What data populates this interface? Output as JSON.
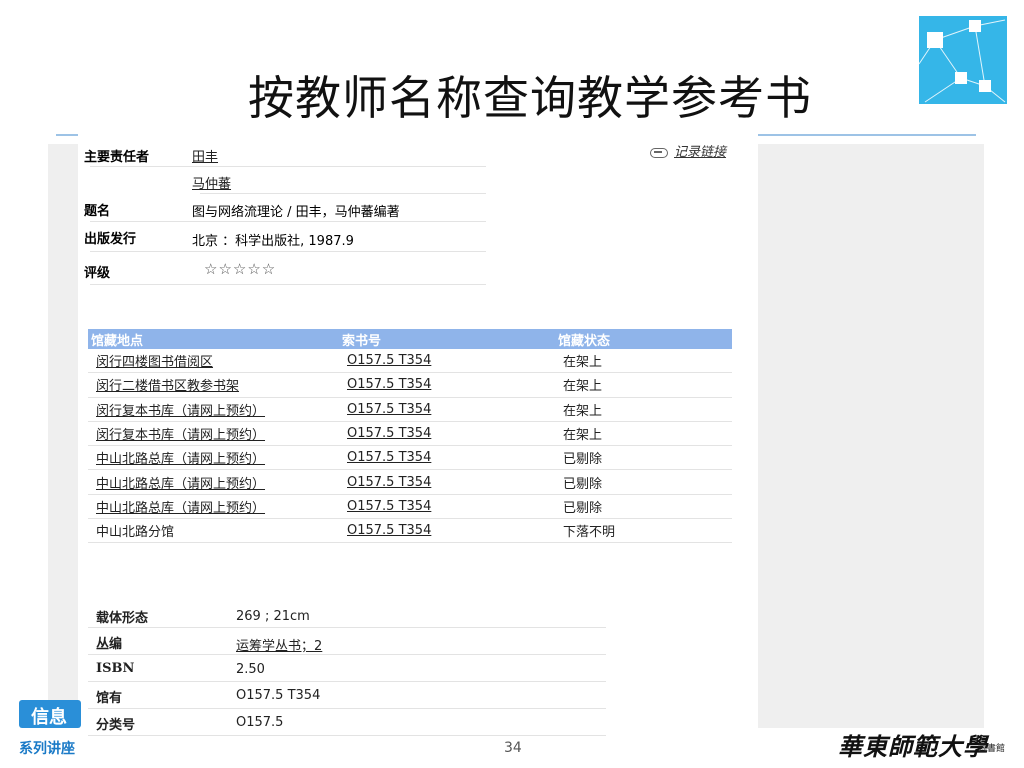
{
  "slide": {
    "title": "按教师名称查询教学参考书",
    "page_number": "34",
    "badge_text": "信息",
    "series_text": "系列讲座",
    "university_name": "華東師範大學",
    "library_label": "圖書館"
  },
  "record": {
    "record_link": "记录链接",
    "fields": {
      "author_label": "主要责任者",
      "authors": [
        "田丰",
        "马仲蕃"
      ],
      "title_label": "题名",
      "title_value": "图与网络流理论 / 田丰，马仲蕃编著",
      "publish_label": "出版发行",
      "publish_value": "北京 ：科学出版社, 1987.9",
      "rating_label": "评级",
      "rating_stars": "☆☆☆☆☆",
      "rating_value": 0
    }
  },
  "holdings": {
    "columns": [
      "馆藏地点",
      "索书号",
      "馆藏状态"
    ],
    "rows": [
      {
        "location": "闵行四楼图书借阅区",
        "call_number": "O157.5 T354",
        "status": "在架上",
        "location_link": true
      },
      {
        "location": "闵行二楼借书区教参书架",
        "call_number": "O157.5 T354",
        "status": "在架上",
        "location_link": true
      },
      {
        "location": "闵行复本书库（请网上预约）",
        "call_number": "O157.5 T354",
        "status": "在架上",
        "location_link": true
      },
      {
        "location": "闵行复本书库（请网上预约）",
        "call_number": "O157.5 T354",
        "status": "在架上",
        "location_link": true
      },
      {
        "location": "中山北路总库（请网上预约）",
        "call_number": "O157.5 T354",
        "status": "已剔除",
        "location_link": true
      },
      {
        "location": "中山北路总库（请网上预约）",
        "call_number": "O157.5 T354",
        "status": "已剔除",
        "location_link": true
      },
      {
        "location": "中山北路总库（请网上预约）",
        "call_number": "O157.5 T354",
        "status": "已剔除",
        "location_link": true
      },
      {
        "location": "中山北路分馆",
        "call_number": "O157.5 T354",
        "status": "下落不明",
        "location_link": false
      }
    ]
  },
  "metadata": {
    "carrier_label": "载体形态",
    "carrier_value": "269 ; 21cm",
    "series_label": "丛编",
    "series_value": "运筹学丛书；2",
    "isbn_label": "ISBN",
    "isbn_value": "2.50",
    "holding_label": "馆有",
    "holding_value": "O157.5 T354",
    "class_label": "分类号",
    "class_value": "O157.5"
  },
  "colors": {
    "table_header": "#8fb4ea",
    "accent_blue": "#35b6e8",
    "badge_blue": "#2a8fd8"
  }
}
